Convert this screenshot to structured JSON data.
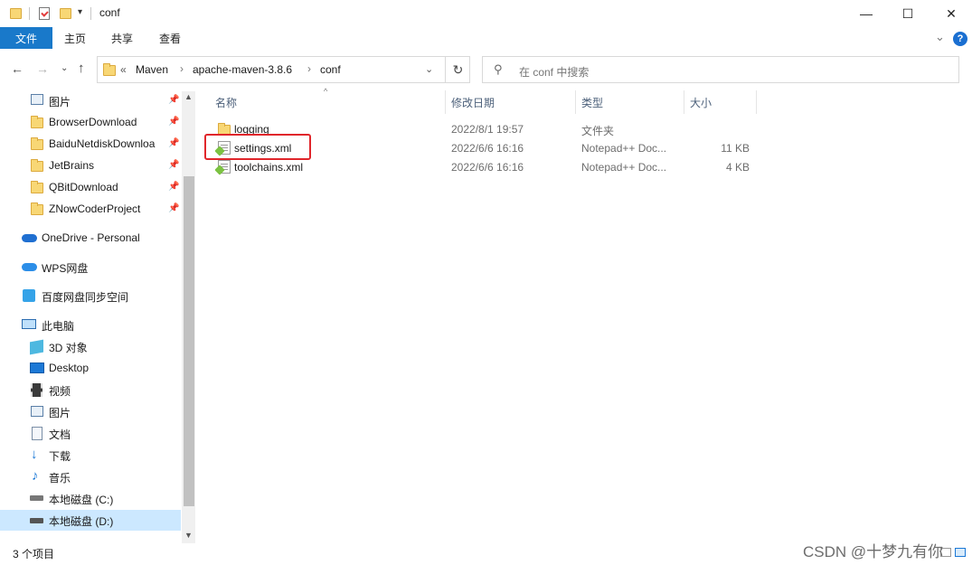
{
  "window": {
    "title": "conf",
    "controls": {
      "minimize": "—",
      "maximize": "☐",
      "close": "✕"
    }
  },
  "ribbon": {
    "tabs": [
      "文件",
      "主页",
      "共享",
      "查看"
    ],
    "expand_chevron": "⌄",
    "help": "?"
  },
  "address": {
    "overflow": "«",
    "crumbs": [
      "Maven",
      "apache-maven-3.8.6",
      "conf"
    ],
    "separator": "›",
    "search_placeholder": "在 conf 中搜索"
  },
  "sidebar": {
    "quick_access": [
      {
        "label": "图片",
        "icon": "pictures-icon",
        "pinned": true
      },
      {
        "label": "BrowserDownload",
        "icon": "folder-icon",
        "pinned": true
      },
      {
        "label": "BaiduNetdiskDownloa",
        "icon": "folder-icon",
        "pinned": true
      },
      {
        "label": "JetBrains",
        "icon": "folder-icon",
        "pinned": true
      },
      {
        "label": "QBitDownload",
        "icon": "folder-icon",
        "pinned": true
      },
      {
        "label": "ZNowCoderProject",
        "icon": "folder-icon",
        "pinned": true
      }
    ],
    "cloud": [
      {
        "label": "OneDrive - Personal",
        "icon": "onedrive-icon"
      },
      {
        "label": "WPS网盘",
        "icon": "wps-cloud-icon"
      },
      {
        "label": "百度网盘同步空间",
        "icon": "baidu-sync-icon"
      }
    ],
    "this_pc": {
      "label": "此电脑",
      "icon": "computer-icon"
    },
    "pc_items": [
      {
        "label": "3D 对象",
        "icon": "3d-objects-icon"
      },
      {
        "label": "Desktop",
        "icon": "desktop-icon"
      },
      {
        "label": "视频",
        "icon": "videos-icon"
      },
      {
        "label": "图片",
        "icon": "pictures-icon"
      },
      {
        "label": "文档",
        "icon": "documents-icon"
      },
      {
        "label": "下载",
        "icon": "downloads-icon"
      },
      {
        "label": "音乐",
        "icon": "music-icon"
      },
      {
        "label": "本地磁盘 (C:)",
        "icon": "drive-c-icon"
      },
      {
        "label": "本地磁盘 (D:)",
        "icon": "drive-d-icon",
        "selected": true
      }
    ]
  },
  "columns": {
    "name": "名称",
    "date": "修改日期",
    "type": "类型",
    "size": "大小"
  },
  "files": [
    {
      "name": "logging",
      "date": "2022/8/1 19:57",
      "type": "文件夹",
      "size": "",
      "icon": "folder-icon"
    },
    {
      "name": "settings.xml",
      "date": "2022/6/6 16:16",
      "type": "Notepad++ Doc...",
      "size": "11 KB",
      "icon": "xml-file-icon",
      "highlighted": true
    },
    {
      "name": "toolchains.xml",
      "date": "2022/6/6 16:16",
      "type": "Notepad++ Doc...",
      "size": "4 KB",
      "icon": "xml-file-icon"
    }
  ],
  "status": {
    "item_count": "3 个项目"
  },
  "watermark": "CSDN @十梦九有你",
  "colors": {
    "ribbon_file_tab": "#1979ca",
    "selection": "#cce8ff",
    "highlight_box": "#e0262b",
    "folder": "#f8d775"
  }
}
